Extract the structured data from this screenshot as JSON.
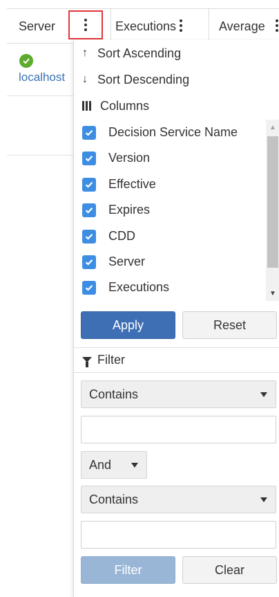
{
  "grid": {
    "columns": [
      {
        "label": "Server"
      },
      {
        "label": "Executions"
      },
      {
        "label": "Average Time"
      }
    ],
    "row": {
      "status": "ok",
      "server": "localhost"
    }
  },
  "menu": {
    "sort_asc": "Sort Ascending",
    "sort_desc": "Sort Descending",
    "columns_title": "Columns",
    "column_options": [
      {
        "label": "Decision Service Name",
        "checked": true
      },
      {
        "label": "Version",
        "checked": true
      },
      {
        "label": "Effective",
        "checked": true
      },
      {
        "label": "Expires",
        "checked": true
      },
      {
        "label": "CDD",
        "checked": true
      },
      {
        "label": "Server",
        "checked": true
      },
      {
        "label": "Executions",
        "checked": true
      }
    ],
    "apply_label": "Apply",
    "reset_label": "Reset",
    "filter_title": "Filter",
    "filter": {
      "operator1": "Contains",
      "value1": "",
      "logic": "And",
      "operator2": "Contains",
      "value2": ""
    },
    "filter_label": "Filter",
    "clear_label": "Clear"
  },
  "colors": {
    "primary": "#3e6fb5",
    "checkbox": "#3d8ee3",
    "status_ok": "#5dab2c",
    "highlight": "#e0353a",
    "link": "#3a73b3"
  },
  "icons": [
    "kebab-icon",
    "sort-asc-icon",
    "sort-desc-icon",
    "columns-icon",
    "check-icon",
    "filter-icon",
    "caret-down-icon",
    "status-ok-icon"
  ]
}
